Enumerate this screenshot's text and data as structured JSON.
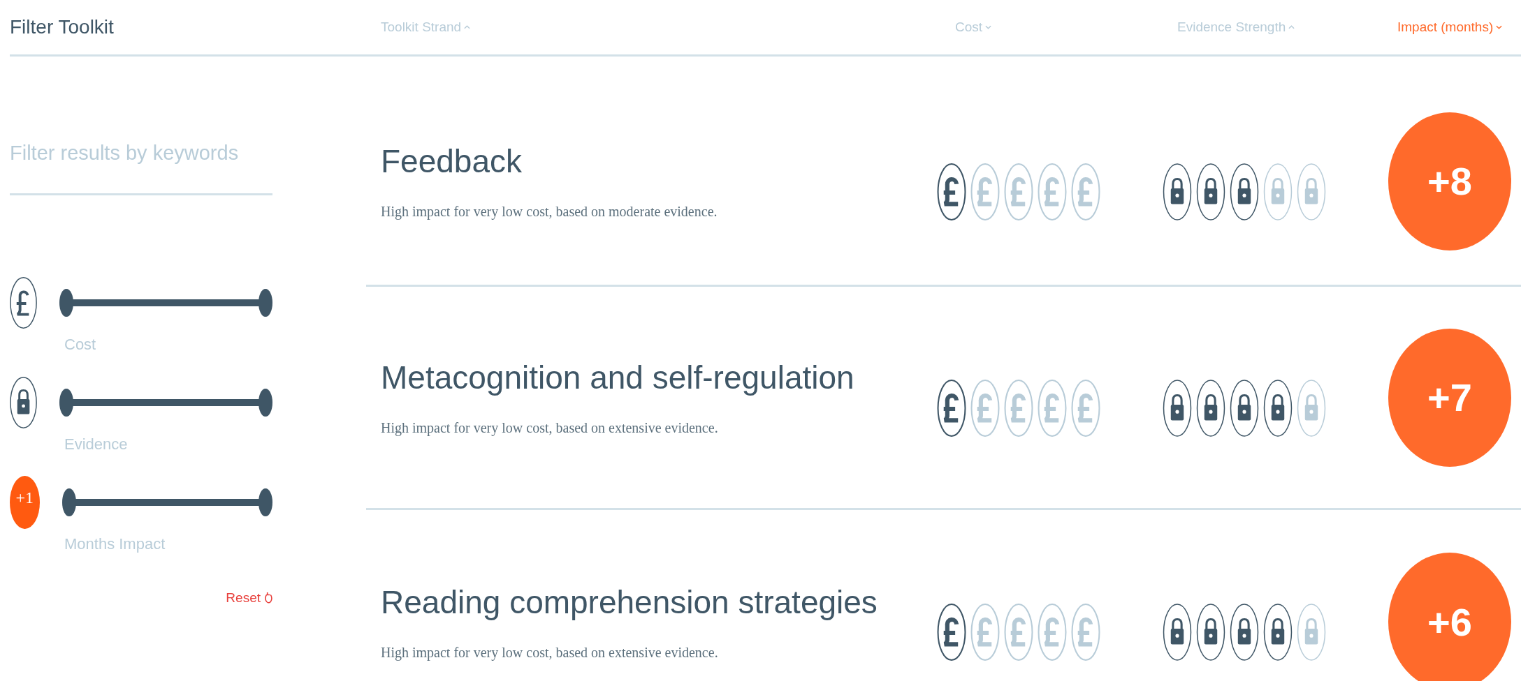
{
  "sidebar_title": "Filter Toolkit",
  "columns": [
    {
      "label": "Toolkit Strand",
      "ascending": true,
      "selected": false
    },
    {
      "label": "Cost",
      "ascending": false,
      "selected": false
    },
    {
      "label": "Evidence Strength",
      "ascending": true,
      "selected": false
    },
    {
      "label": "Impact (months)",
      "ascending": false,
      "selected": true
    }
  ],
  "search": {
    "placeholder": "Filter results by keywords"
  },
  "filters": [
    {
      "kind": "cost",
      "label": "Cost",
      "level": 1
    },
    {
      "kind": "evidence",
      "label": "Evidence",
      "level": 1
    },
    {
      "kind": "impact",
      "badge": "+1",
      "label": "Months Impact",
      "level": 1
    }
  ],
  "reset": "Reset",
  "rows": [
    {
      "title": "Feedback",
      "description": "High impact for very low cost, based on moderate evidence.",
      "cost": {
        "stars": 1
      },
      "evidence": {
        "stars": 3
      },
      "impact": "+8"
    },
    {
      "title": "Metacognition and self-regulation",
      "description": "High impact for very low cost, based on extensive evidence.",
      "cost": {
        "stars": 1
      },
      "evidence": {
        "stars": 4
      },
      "impact": "+7"
    },
    {
      "title": "Reading comprehension strategies",
      "description": "High impact for very low cost, based on extensive evidence.",
      "cost": {
        "stars": 1
      },
      "evidence": {
        "stars": 4
      },
      "impact": "+6"
    }
  ]
}
